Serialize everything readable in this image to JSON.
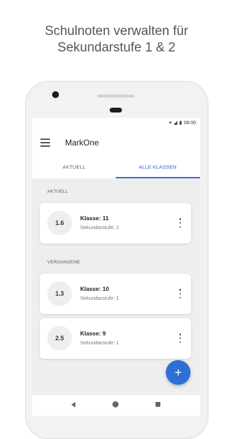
{
  "headline": {
    "line1": "Schulnoten verwalten für",
    "line2": "Sekundarstufe 1 & 2"
  },
  "statusbar": {
    "time": "08:00",
    "icons": [
      "wifi-icon",
      "signal-icon",
      "battery-icon"
    ]
  },
  "appbar": {
    "title": "MarkOne",
    "tabs": [
      {
        "label": "AKTUELL",
        "active": false
      },
      {
        "label": "ALLE KLASSEN",
        "active": true
      }
    ]
  },
  "sections": [
    {
      "label": "AKTUELL",
      "cards": [
        {
          "grade": "1.6",
          "title": "Klasse: 11",
          "subtitle": "Sekundarstufe: 2"
        }
      ]
    },
    {
      "label": "VERGANGENE",
      "cards": [
        {
          "grade": "1.3",
          "title": "Klasse: 10",
          "subtitle": "Sekundarstufe: 1"
        },
        {
          "grade": "2.5",
          "title": "Klasse: 9",
          "subtitle": "Sekundarstufe: 1"
        }
      ]
    }
  ],
  "fab": {
    "label": "+",
    "icon": "plus-icon"
  },
  "colors": {
    "accent": "#2e6fd6",
    "background": "#eeeeee"
  }
}
